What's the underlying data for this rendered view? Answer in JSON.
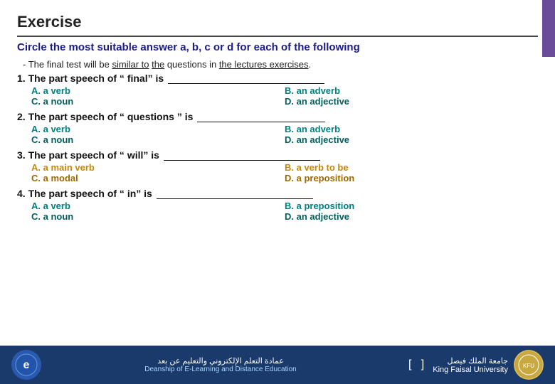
{
  "page": {
    "title": "Exercise",
    "instruction": "Circle the most suitable answer a, b, c or d for each of the following",
    "intro": "- The final test will be similar to the questions in the lectures exercises.",
    "questions": [
      {
        "number": "1.",
        "text": "The part speech of “ final” is ",
        "answers": [
          {
            "label": "A. a verb",
            "color": "teal",
            "side": "left"
          },
          {
            "label": "B. an adverb",
            "color": "teal",
            "side": "right"
          },
          {
            "label": "C. a noun",
            "color": "dark-teal",
            "side": "left"
          },
          {
            "label": "D. an adjective",
            "color": "dark-teal",
            "side": "right"
          }
        ]
      },
      {
        "number": "2.",
        "text": "The part speech of “ questions ” is ",
        "answers": [
          {
            "label": "A. a verb",
            "color": "teal",
            "side": "left"
          },
          {
            "label": "B. an adverb",
            "color": "teal",
            "side": "right"
          },
          {
            "label": "C. a noun",
            "color": "dark-teal",
            "side": "left"
          },
          {
            "label": "D. an adjective",
            "color": "dark-teal",
            "side": "right"
          }
        ]
      },
      {
        "number": "3.",
        "text": "The part speech of “ will” is ",
        "answers": [
          {
            "label": "A. a main verb",
            "color": "orange",
            "side": "left"
          },
          {
            "label": "B. a verb to be",
            "color": "orange",
            "side": "right"
          },
          {
            "label": "C. a modal",
            "color": "dark-orange",
            "side": "left"
          },
          {
            "label": "D. a preposition",
            "color": "dark-orange",
            "side": "right"
          }
        ]
      },
      {
        "number": "4.",
        "text": "The part speech of “ in” is ",
        "answers": [
          {
            "label": "A. a verb",
            "color": "teal",
            "side": "left"
          },
          {
            "label": "B. a preposition",
            "color": "teal",
            "side": "right"
          },
          {
            "label": "C. a noun",
            "color": "dark-teal",
            "side": "left"
          },
          {
            "label": "D. an adjective",
            "color": "dark-teal",
            "side": "right"
          }
        ]
      }
    ],
    "footer": {
      "logo_letter": "e",
      "arabic_text": "عمادة التعلم الإلكتروني والتعليم عن بعد",
      "arabic_sub": "Deanship of E-Learning and Distance Education",
      "brackets": "[ ]",
      "university_arabic": "جامعة الملك فيصل",
      "university_english": "King Faisal University"
    }
  }
}
